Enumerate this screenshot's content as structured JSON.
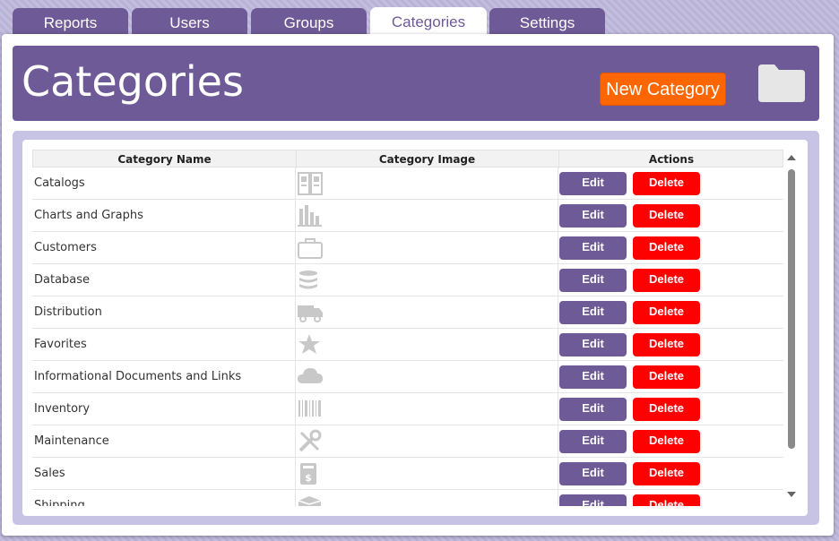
{
  "tabs": [
    {
      "label": "Reports",
      "active": false
    },
    {
      "label": "Users",
      "active": false
    },
    {
      "label": "Groups",
      "active": false
    },
    {
      "label": "Categories",
      "active": true
    },
    {
      "label": "Settings",
      "active": false
    }
  ],
  "header": {
    "title": "Categories",
    "new_button_label": "New Category",
    "folder_icon": "folder-icon"
  },
  "table": {
    "columns": [
      "Category Name",
      "Category Image",
      "Actions"
    ],
    "edit_label": "Edit",
    "delete_label": "Delete",
    "rows": [
      {
        "name": "Catalogs",
        "icon": "catalog-icon"
      },
      {
        "name": "Charts and Graphs",
        "icon": "bar-chart-icon"
      },
      {
        "name": "Customers",
        "icon": "briefcase-icon"
      },
      {
        "name": "Database",
        "icon": "database-icon"
      },
      {
        "name": "Distribution",
        "icon": "truck-icon"
      },
      {
        "name": "Favorites",
        "icon": "star-icon"
      },
      {
        "name": "Informational Documents and Links",
        "icon": "cloud-icon"
      },
      {
        "name": "Inventory",
        "icon": "barcode-icon"
      },
      {
        "name": "Maintenance",
        "icon": "tools-icon"
      },
      {
        "name": "Sales",
        "icon": "receipt-icon"
      },
      {
        "name": "Shipping",
        "icon": "box-icon"
      }
    ]
  },
  "colors": {
    "accent": "#6e5a96",
    "new_button": "#ff6600",
    "delete": "#ff0000",
    "icon_gray": "#c8c8c8"
  }
}
